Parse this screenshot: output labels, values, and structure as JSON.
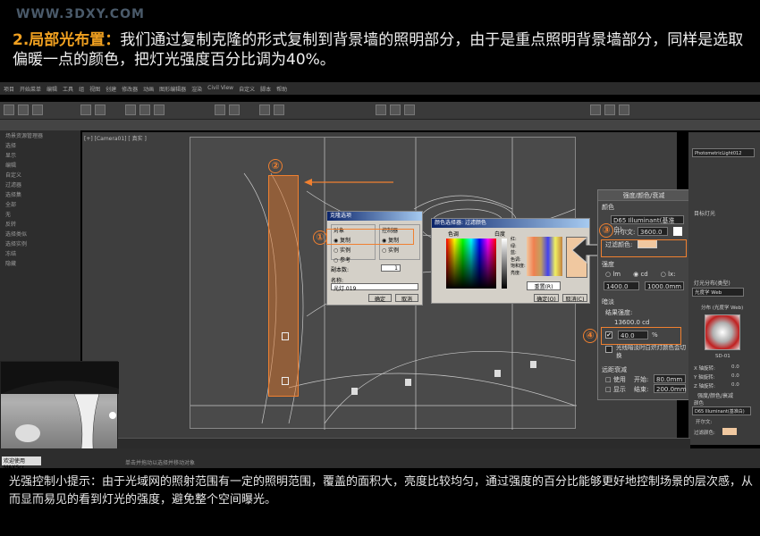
{
  "watermark": "WWW.3DXY.COM",
  "heading": {
    "prefix": "2.局部光布置：",
    "text": "我们通过复制克隆的形式复制到背景墙的照明部分，由于是重点照明背景墙部分，同样是选取偏暖一点的颜色，把灯光强度百分比调为40%。"
  },
  "clone_dialog": {
    "title": "克隆选项",
    "object_group": "对象",
    "controller_group": "控制器",
    "options": [
      "复制",
      "实例",
      "参考"
    ],
    "copies_label": "副本数:",
    "copies_value": "1",
    "name_label": "名称:",
    "name_value": "光灯 019",
    "ok": "确定",
    "cancel": "取消"
  },
  "color_dialog": {
    "title": "颜色选择器: 过滤颜色",
    "hue_label": "色调",
    "white_label": "白度",
    "channels": [
      "红:",
      "绿:",
      "蓝:",
      "色调:",
      "饱和度:",
      "亮度:"
    ],
    "reset": "重置(R)",
    "ok": "确定(O)",
    "cancel": "取消(C)"
  },
  "rollout": {
    "title": "强度/颜色/衰减",
    "color_group": "颜色",
    "color_preset": "D65 Illuminant(基准白)",
    "kelvin_label": "开尔文:",
    "kelvin_value": "3600.0",
    "filter_label": "过滤颜色:",
    "intensity_group": "强度",
    "units": [
      "lm",
      "cd",
      "lx:"
    ],
    "intensity_value": "1400.0",
    "distance_value": "1000.0mm",
    "dimming_group": "暗淡",
    "result_label": "结果强度:",
    "result_value": "13600.0 cd",
    "percent_value": "40.0",
    "percent_unit": "%",
    "halogen_label": "光线暗淡时白炽灯颜色会切换",
    "far_atten_group": "远距衰减",
    "use_label": "使用",
    "show_label": "显示",
    "start_label": "开始:",
    "start_value": "80.0mm",
    "end_label": "结束:",
    "end_value": "200.0mm"
  },
  "right_panel": {
    "light_dist_label": "灯光分布(类型)",
    "light_dist_value": "光度学 Web",
    "dist_web_label": "分布 (光度学 Web)",
    "web_file": "SD-01",
    "x_rot": "X 轴旋转:",
    "y_rot": "Y 轴旋转:",
    "z_rot": "Z 轴旋转:",
    "rot_value": "0.0",
    "rollout2_title": "强度/颜色/衰减",
    "color2": "颜色",
    "preset2": "D65 Illuminant(基准白)",
    "kelvin2": "开尔文:",
    "filter2": "过滤颜色:",
    "target_label": "目标灯光",
    "name_field": "PhotometricLight012"
  },
  "viewport_label": "[+] [Camera01] [ 真实 ]",
  "menubar": [
    "项目",
    "开始菜单",
    "编辑",
    "工具",
    "组",
    "视图",
    "创建",
    "修改器",
    "动画",
    "图形编辑器",
    "渲染",
    "Civil View",
    "自定义",
    "脚本",
    "帮助"
  ],
  "left_panel": [
    "场景资源管理器",
    "选择",
    "显示",
    "编辑",
    "自定义",
    "过滤器",
    "选择集",
    "全部",
    "无",
    "反转",
    "选择类似",
    "选择实例",
    "冻结",
    "隐藏"
  ],
  "tip": "光强控制小提示：由于光域网的照射范围有一定的照明范围，覆盖的面积大，亮度比较均匀，通过强度的百分比能够更好地控制场景的层次感，从而显而易见的看到灯光的强度，避免整个空间曝光。",
  "status": {
    "welcome": "欢迎使用 MAXScr",
    "hint": "单击并拖动以选择并移动对象"
  },
  "markers": [
    "①",
    "②",
    "③",
    "④"
  ],
  "colors": {
    "accent": "#f08030",
    "heading_accent": "#f0a020",
    "filter_color": "#f0c8a0"
  }
}
